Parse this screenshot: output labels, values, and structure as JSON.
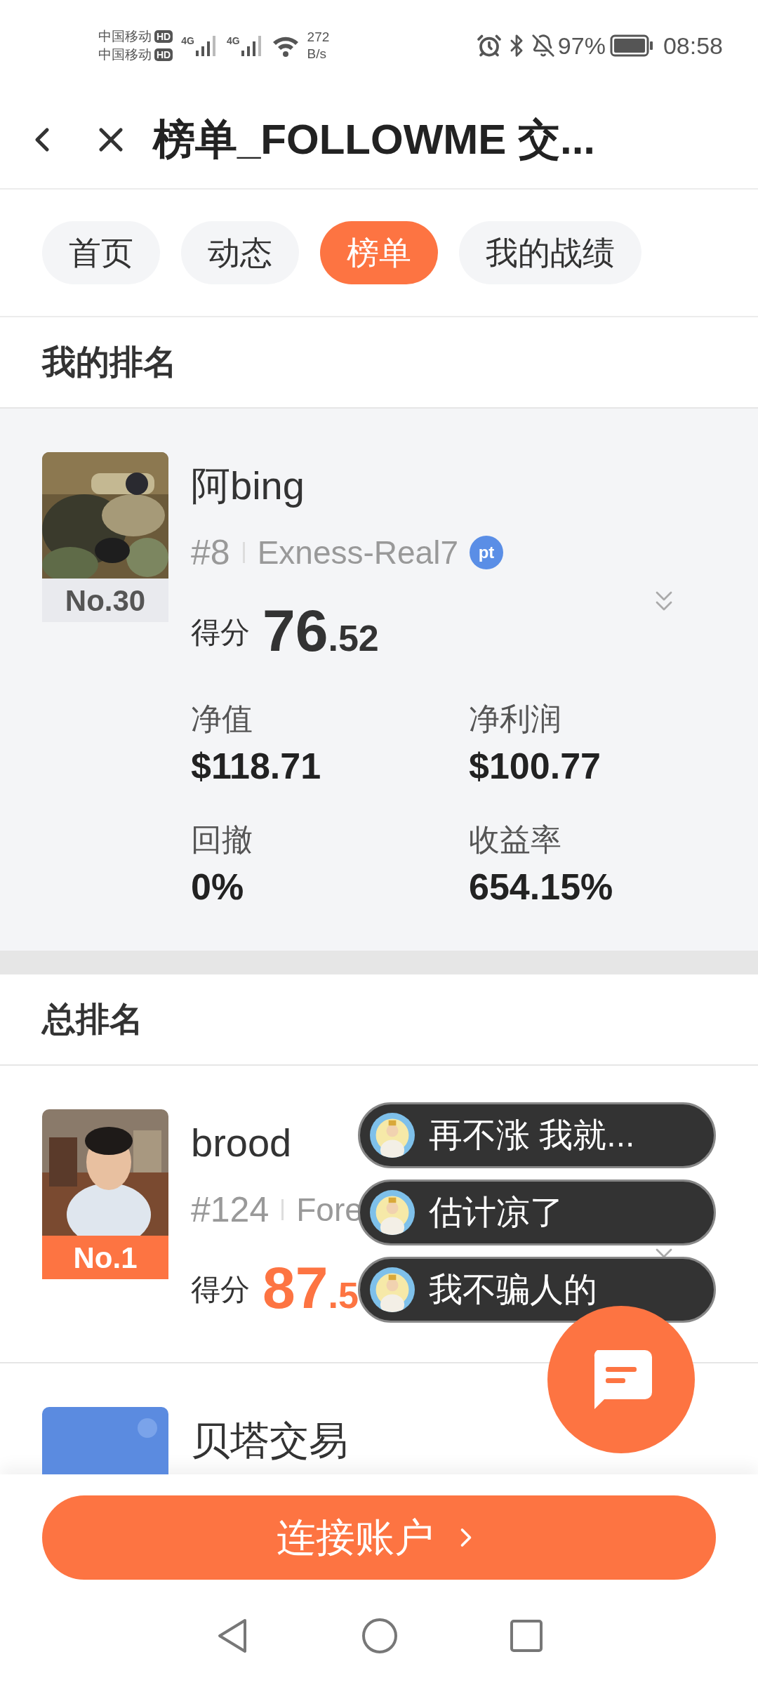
{
  "status_bar": {
    "carriers": [
      {
        "name": "中国移动",
        "badge": "HD"
      },
      {
        "name": "中国移动",
        "badge": "HD"
      }
    ],
    "networks": [
      "4G",
      "4G"
    ],
    "speed_value": "272",
    "speed_unit": "B/s",
    "battery": "97%",
    "time": "08:58"
  },
  "header": {
    "title": "榜单_FOLLOWME 交..."
  },
  "tabs": [
    {
      "label": "首页",
      "selected": false
    },
    {
      "label": "动态",
      "selected": false
    },
    {
      "label": "榜单",
      "selected": true
    },
    {
      "label": "我的战绩",
      "selected": false
    }
  ],
  "my_ranking": {
    "heading": "我的排名",
    "entry": {
      "kind": "normal",
      "rank": "No.30",
      "name": "阿bing",
      "position": "#8",
      "broker": "Exness-Real7",
      "broker_badge": "pt",
      "score_label": "得分",
      "score_int": "76",
      "score_dec": ".52",
      "stats": [
        {
          "label": "净值",
          "value": "$118.71"
        },
        {
          "label": "净利润",
          "value": "$100.77"
        },
        {
          "label": "回撤",
          "value": "0%"
        },
        {
          "label": "收益率",
          "value": "654.15%"
        }
      ]
    }
  },
  "overall": {
    "heading": "总排名",
    "entries": [
      {
        "kind": "top",
        "rank": "No.1",
        "name": "brood",
        "position": "#124",
        "broker": "Fore",
        "score_label": "得分",
        "score_int": "87",
        "score_dec": ".5"
      },
      {
        "name": "贝塔交易"
      }
    ]
  },
  "chat_bubbles": [
    {
      "text": "再不涨 我就..."
    },
    {
      "text": "估计凉了"
    },
    {
      "text": "我不骗人的"
    }
  ],
  "connect_button": {
    "label": "连接账户"
  }
}
